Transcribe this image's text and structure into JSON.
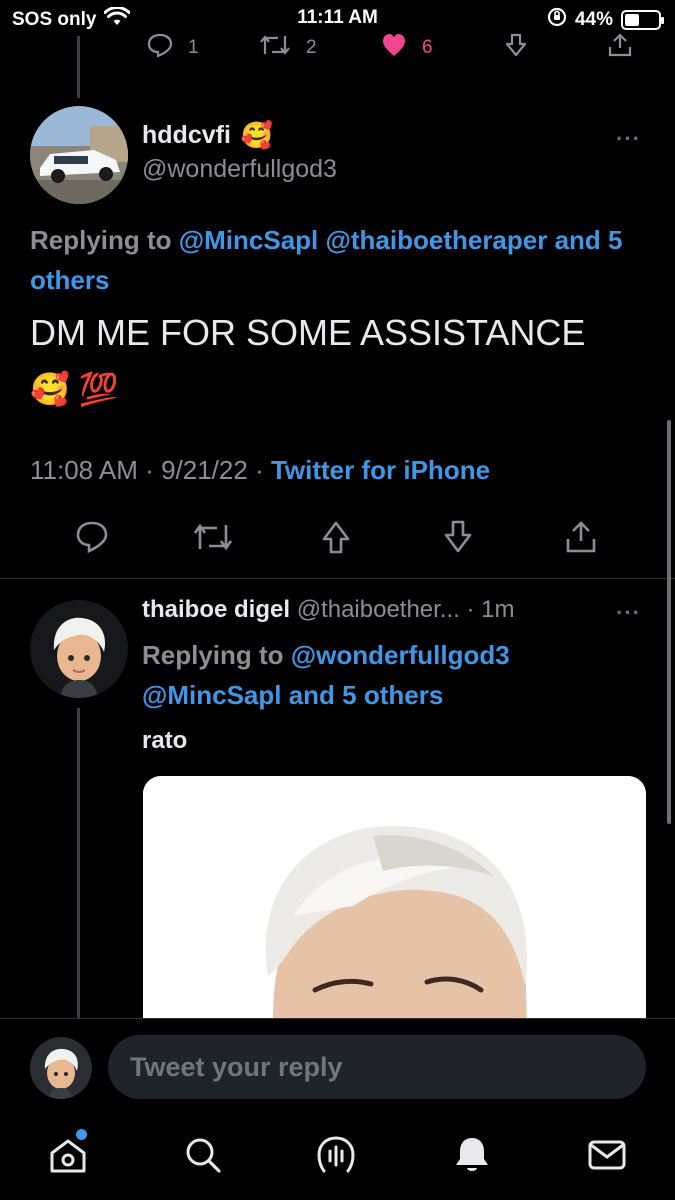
{
  "status": {
    "carrier": "SOS only",
    "time": "11:11 AM",
    "battery_percent": "44%",
    "battery_level": 0.44,
    "icons": [
      "wifi-icon",
      "orientation-lock-icon",
      "battery-icon"
    ]
  },
  "previous_tweet_actions": {
    "reply_count": "1",
    "retweet_count": "2",
    "like_count": "6",
    "like_color": "#f4468e"
  },
  "main_tweet": {
    "display_name": "hddcvfi",
    "name_emoji": "🥰",
    "handle": "@wonderfullgod3",
    "replying_prefix": "Replying to",
    "replying_mention_1": "@MincSapl",
    "replying_mention_2": "@thaiboetheraper",
    "replying_others": "and 5 others",
    "text": "DM ME FOR SOME ASSISTANCE",
    "text_emojis": "🥰 💯",
    "time": "11:08 AM",
    "sep": "·",
    "date": "9/21/22",
    "source": "Twitter for iPhone"
  },
  "reply_tweet": {
    "display_name": "thaiboe digel",
    "handle": "@thaiboether...",
    "sep": "·",
    "age": "1m",
    "replying_prefix": "Replying to",
    "replying_mention_1": "@wonderfullgod3",
    "replying_mention_2": "@MincSapl",
    "replying_others": "and 5 others",
    "text": "rato"
  },
  "compose": {
    "placeholder": "Tweet your reply"
  },
  "tabs": [
    "home-icon",
    "search-icon",
    "spaces-icon",
    "notifications-icon",
    "messages-icon"
  ],
  "colors": {
    "accent": "#3f97e8",
    "background": "#000000",
    "muted": "#8b8f94"
  }
}
